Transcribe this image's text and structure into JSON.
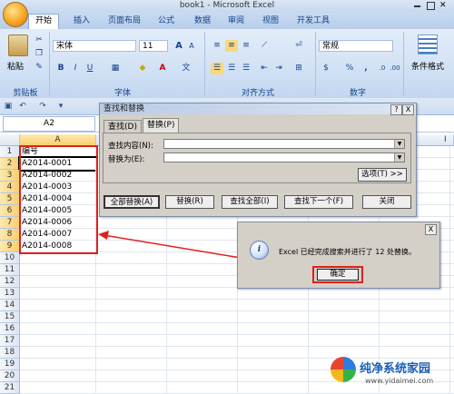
{
  "window": {
    "title": "book1 - Microsoft Excel"
  },
  "ribbon": {
    "tabs": [
      "开始",
      "插入",
      "页面布局",
      "公式",
      "数据",
      "审阅",
      "视图",
      "开发工具"
    ],
    "clipboard": {
      "paste": "粘贴",
      "group": "剪贴板"
    },
    "font": {
      "name": "宋体",
      "size": "11",
      "grow": "A",
      "shrink": "A",
      "bold": "B",
      "italic": "I",
      "underline": "U",
      "group": "字体"
    },
    "alignment": {
      "group": "对齐方式"
    },
    "number": {
      "format": "常规",
      "percent": "%",
      "comma": ",",
      "group": "数字"
    },
    "styles": {
      "conditional": "条件格式"
    }
  },
  "formula_bar": {
    "name_box": "A2"
  },
  "sheet": {
    "column_a": "A",
    "column_i": "I",
    "rows": [
      "1",
      "2",
      "3",
      "4",
      "5",
      "6",
      "7",
      "8",
      "9",
      "10",
      "11",
      "12",
      "13",
      "14",
      "15",
      "16",
      "17",
      "18",
      "19",
      "20",
      "21"
    ],
    "cells_a": [
      "编号",
      "A2014-0001",
      "A2014-0002",
      "A2014-0003",
      "A2014-0004",
      "A2014-0005",
      "A2014-0006",
      "A2014-0007",
      "A2014-0008"
    ]
  },
  "find_dialog": {
    "title": "查找和替换",
    "help": "?",
    "close": "X",
    "tab_find": "查找(D)",
    "tab_replace": "替换(P)",
    "find_label": "查找内容(N):",
    "replace_label": "替换为(E):",
    "options": "选项(T) >>",
    "btn_replace_all": "全部替换(A)",
    "btn_replace": "替换(R)",
    "btn_find_all": "查找全部(I)",
    "btn_find_next": "查找下一个(F)",
    "btn_close": "关闭"
  },
  "message_box": {
    "close": "X",
    "text": "Excel 已经完成搜索并进行了 12 处替换。",
    "ok": "确定"
  },
  "watermark": {
    "name": "纯净系统家园",
    "url": "www.yidaimei.com"
  },
  "colors": {
    "highlight_red": "#e0201e",
    "ribbon_blue": "#15428b"
  }
}
